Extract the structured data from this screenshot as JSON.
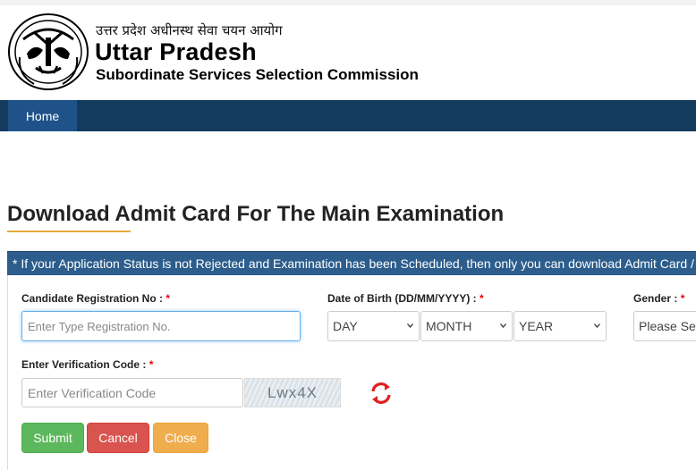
{
  "header": {
    "hindi_title": "उत्तर प्रदेश अधीनस्थ सेवा चयन आयोग",
    "title": "Uttar Pradesh",
    "subtitle": "Subordinate Services Selection Commission"
  },
  "nav": {
    "items": [
      {
        "label": "Home"
      }
    ]
  },
  "page": {
    "heading": "Download Admit Card For The Main Examination",
    "notice": "* If your Application Status is not Rejected and Examination has been Scheduled, then only you can download Admit Card / Call Letter"
  },
  "form": {
    "registration": {
      "label": "Candidate Registration No :",
      "required": "*",
      "placeholder": "Enter Type Registration No."
    },
    "dob": {
      "label": "Date of Birth (DD/MM/YYYY) :",
      "required": "*",
      "day": "DAY",
      "month": "MONTH",
      "year": "YEAR"
    },
    "gender": {
      "label": "Gender :",
      "required": "*",
      "value": "Please Select"
    },
    "verification": {
      "label": "Enter Verification Code :",
      "required": "*",
      "placeholder": "Enter Verification Code",
      "captcha_text": "Lwx4X"
    },
    "buttons": {
      "submit": "Submit",
      "cancel": "Cancel",
      "close": "Close"
    }
  },
  "colors": {
    "nav_bg": "#143a5e",
    "nav_active": "#1f5289",
    "notice_bg": "#2c5d8c",
    "accent_underline": "#e7a93a",
    "required": "#ee0000",
    "submit": "#5cb85c",
    "cancel": "#d9534f",
    "close": "#f0ad4e",
    "refresh_icon": "#e02020"
  }
}
